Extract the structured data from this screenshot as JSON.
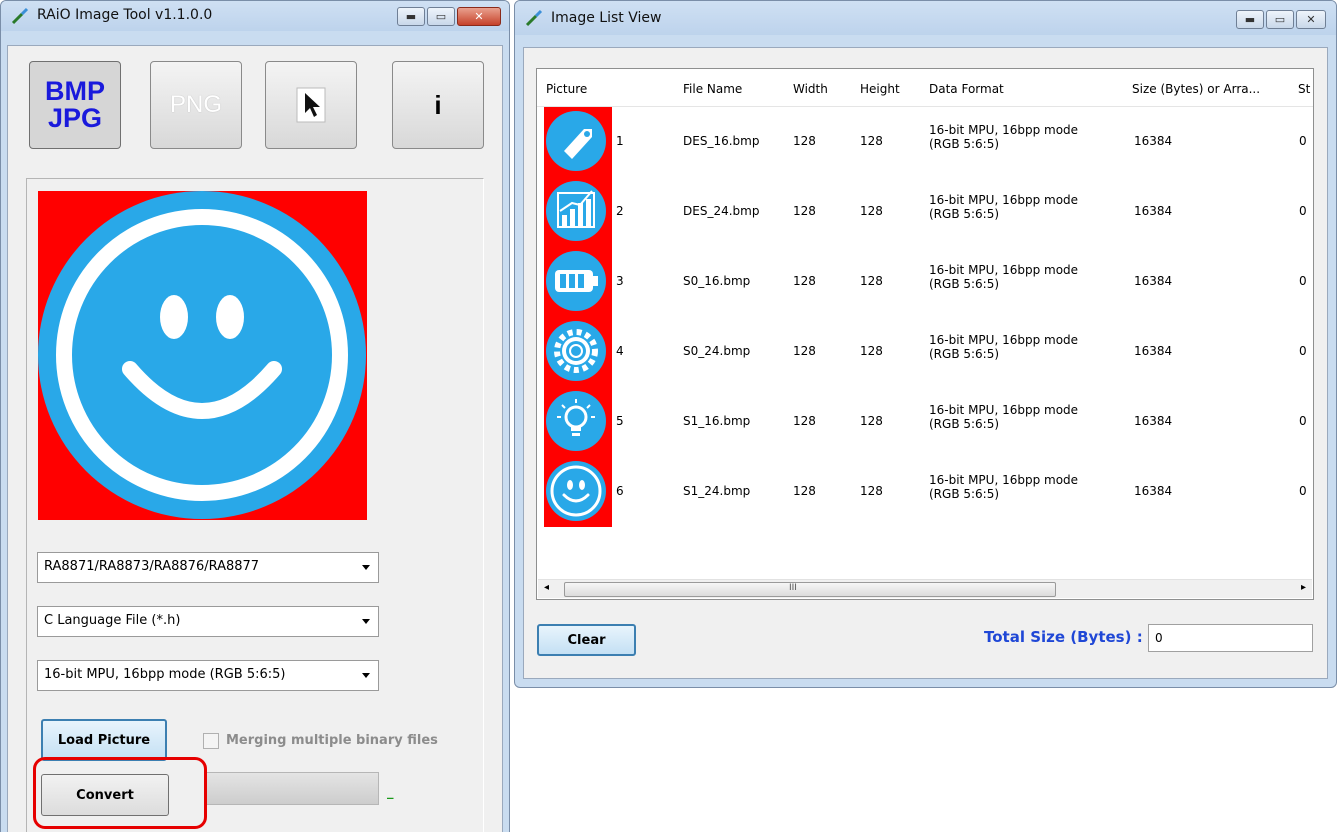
{
  "left_window": {
    "title": "RAiO Image Tool v1.1.0.0",
    "toolbar": {
      "bmp_line1": "BMP",
      "bmp_line2": "JPG",
      "png_label": "PNG",
      "info_label": "i"
    },
    "combos": {
      "chip": "RA8871/RA8873/RA8876/RA8877",
      "file_type": "C Language File (*.h)",
      "data_format": "16-bit MPU, 16bpp mode (RGB 5:6:5)"
    },
    "load_picture_label": "Load Picture",
    "merge_checkbox_label": "Merging multiple binary files",
    "merge_checked": false,
    "convert_label": "Convert",
    "progress_fraction": 0,
    "progress_trailing_text": "_"
  },
  "right_window": {
    "title": "Image List View",
    "columns": [
      "Picture",
      "File Name",
      "Width",
      "Height",
      "Data Format",
      "Size (Bytes) or Arra...",
      "St"
    ],
    "rows": [
      {
        "index": "1",
        "icon": "tag-icon",
        "file": "DES_16.bmp",
        "width": "128",
        "height": "128",
        "format_line1": "16-bit MPU, 16bpp mode",
        "format_line2": "(RGB 5:6:5)",
        "size": "16384",
        "st": "0"
      },
      {
        "index": "2",
        "icon": "bar-chart-icon",
        "file": "DES_24.bmp",
        "width": "128",
        "height": "128",
        "format_line1": "16-bit MPU, 16bpp mode",
        "format_line2": "(RGB 5:6:5)",
        "size": "16384",
        "st": "0"
      },
      {
        "index": "3",
        "icon": "battery-icon",
        "file": "S0_16.bmp",
        "width": "128",
        "height": "128",
        "format_line1": "16-bit MPU, 16bpp mode",
        "format_line2": "(RGB 5:6:5)",
        "size": "16384",
        "st": "0"
      },
      {
        "index": "4",
        "icon": "gear-icon",
        "file": "S0_24.bmp",
        "width": "128",
        "height": "128",
        "format_line1": "16-bit MPU, 16bpp mode",
        "format_line2": "(RGB 5:6:5)",
        "size": "16384",
        "st": "0"
      },
      {
        "index": "5",
        "icon": "lightbulb-icon",
        "file": "S1_16.bmp",
        "width": "128",
        "height": "128",
        "format_line1": "16-bit MPU, 16bpp mode",
        "format_line2": "(RGB 5:6:5)",
        "size": "16384",
        "st": "0"
      },
      {
        "index": "6",
        "icon": "smiley-icon",
        "file": "S1_24.bmp",
        "width": "128",
        "height": "128",
        "format_line1": "16-bit MPU, 16bpp mode",
        "format_line2": "(RGB 5:6:5)",
        "size": "16384",
        "st": "0"
      }
    ],
    "scrollbar_grip": "III",
    "clear_label": "Clear",
    "total_label": "Total Size (Bytes) :",
    "total_value": "0"
  },
  "colors": {
    "thumb_bg": "#ff0000",
    "icon_fill": "#29a8e8",
    "accent_text": "#1f47d6",
    "highlight_box": "#e60000"
  }
}
